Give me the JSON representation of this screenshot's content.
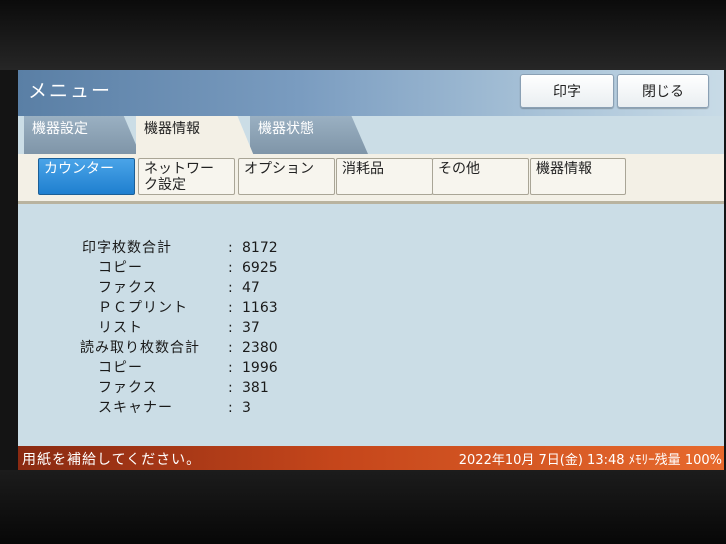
{
  "header": {
    "title": "メニュー",
    "print_button": "印字",
    "close_button": "閉じる"
  },
  "main_tabs": [
    {
      "label": "機器設定",
      "active": false
    },
    {
      "label": "機器情報",
      "active": true
    },
    {
      "label": "機器状態",
      "active": false
    }
  ],
  "sub_tabs": [
    {
      "label": "カウンター",
      "active": true
    },
    {
      "label": "ネットワーク設定",
      "line1": "ネットワー",
      "line2": "ク設定",
      "active": false
    },
    {
      "label": "オプション",
      "active": false
    },
    {
      "label": "消耗品",
      "active": false
    },
    {
      "label": "その他",
      "active": false
    },
    {
      "label": "機器情報",
      "active": false
    }
  ],
  "counters": [
    {
      "label": "印字枚数合計",
      "value": "8172",
      "indent": false
    },
    {
      "label": "コピー",
      "value": "6925",
      "indent": true
    },
    {
      "label": "ファクス",
      "value": "47",
      "indent": true
    },
    {
      "label": "ＰＣプリント",
      "value": "1163",
      "indent": true
    },
    {
      "label": "リスト",
      "value": "37",
      "indent": true
    },
    {
      "label": "読み取り枚数合計",
      "value": "2380",
      "indent": false
    },
    {
      "label": "コピー",
      "value": "1996",
      "indent": true
    },
    {
      "label": "ファクス",
      "value": "381",
      "indent": true
    },
    {
      "label": "スキャナー",
      "value": "3",
      "indent": true
    }
  ],
  "separator": ":",
  "status": {
    "message": "用紙を補給してください。",
    "datetime": "2022年10月  7日(金) 13:48",
    "memory_label": "ﾒﾓﾘｰ残量",
    "memory_value": "100%"
  },
  "colors": {
    "screen_bg": "#cbdde6",
    "active_subtab": "#1f7fcf",
    "status_bar": "#c5461b"
  }
}
